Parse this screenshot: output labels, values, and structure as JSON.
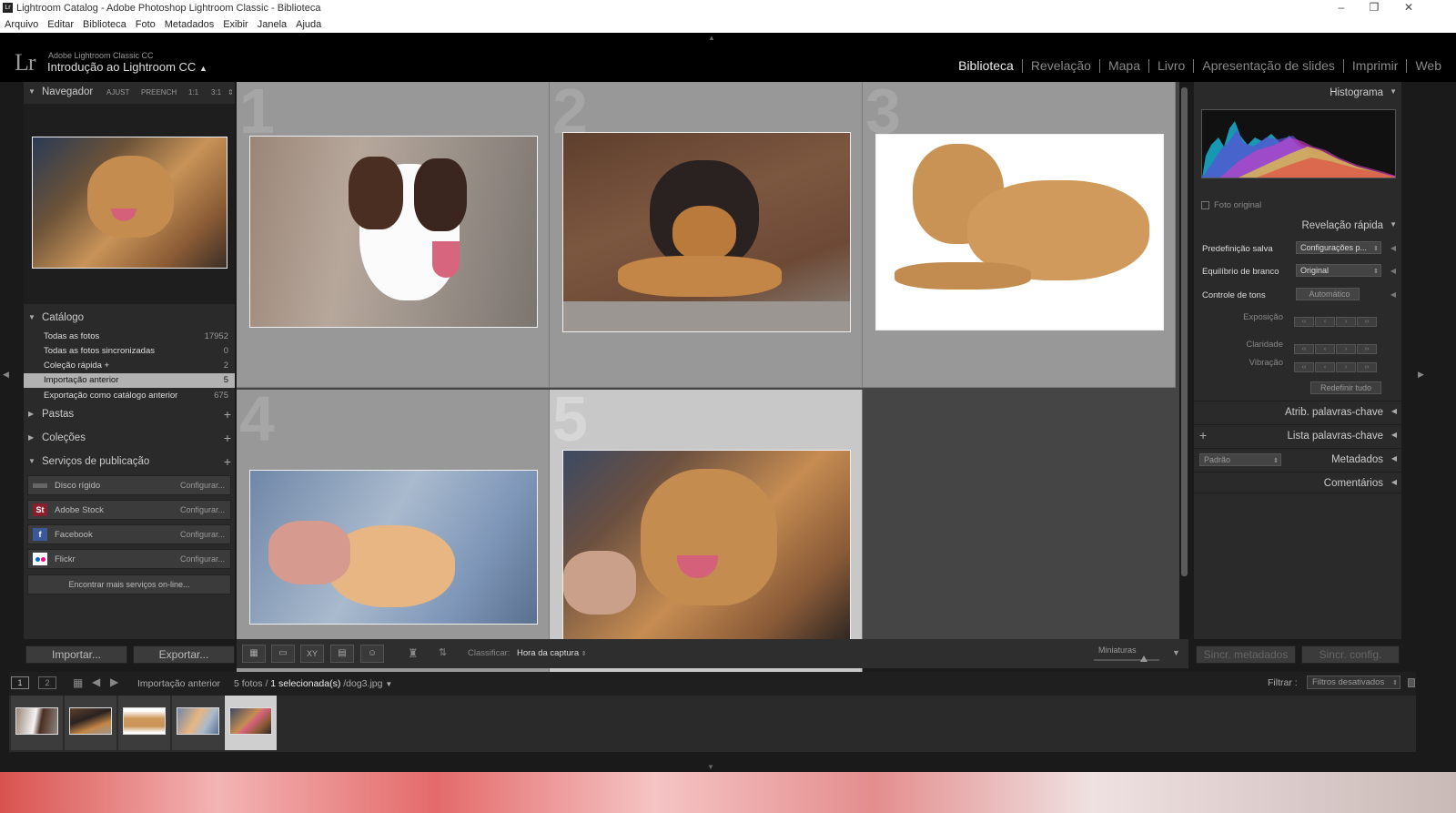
{
  "window": {
    "title": "Lightroom Catalog - Adobe Photoshop Lightroom Classic - Biblioteca",
    "minimize": "–",
    "maximize": "❐",
    "close": "✕"
  },
  "menu": [
    "Arquivo",
    "Editar",
    "Biblioteca",
    "Foto",
    "Metadados",
    "Exibir",
    "Janela",
    "Ajuda"
  ],
  "identity": {
    "logo": "Lr",
    "app_name": "Adobe Lightroom Classic CC",
    "catalog_name": "Introdução ao Lightroom CC",
    "modules": [
      "Biblioteca",
      "Revelação",
      "Mapa",
      "Livro",
      "Apresentação de slides",
      "Imprimir",
      "Web"
    ],
    "active_module": "Biblioteca"
  },
  "navigator": {
    "title": "Navegador",
    "options": [
      "AJUST",
      "PREENCH",
      "1:1",
      "3:1"
    ]
  },
  "catalog": {
    "title": "Catálogo",
    "rows": [
      {
        "name": "Todas as fotos",
        "count": "17952"
      },
      {
        "name": "Todas as fotos sincronizadas",
        "count": "0"
      },
      {
        "name": "Coleção rápida +",
        "count": "2"
      },
      {
        "name": "Importação anterior",
        "count": "5"
      },
      {
        "name": "Exportação como catálogo anterior",
        "count": "675"
      }
    ],
    "selected_index": 3
  },
  "folders": {
    "title": "Pastas"
  },
  "collections": {
    "title": "Coleções"
  },
  "publish": {
    "title": "Serviços de publicação",
    "services": [
      {
        "name": "Disco rígido",
        "configure": "Configurar..."
      },
      {
        "name": "Adobe Stock",
        "configure": "Configurar...",
        "icon": "St"
      },
      {
        "name": "Facebook",
        "configure": "Configurar...",
        "icon": "f"
      },
      {
        "name": "Flickr",
        "configure": "Configurar..."
      }
    ],
    "find_more": "Encontrar mais serviços on-line..."
  },
  "grid": {
    "cells": [
      {
        "number": "1"
      },
      {
        "number": "2"
      },
      {
        "number": "3"
      },
      {
        "number": "4"
      },
      {
        "number": "5"
      }
    ],
    "selected_index": 4
  },
  "right": {
    "histogram": "Histograma",
    "original_photo": "Foto original",
    "quick_develop": "Revelação rápida",
    "saved_preset_label": "Predefinição salva",
    "saved_preset_value": "Configurações p...",
    "white_balance_label": "Equilíbrio de branco",
    "white_balance_value": "Original",
    "tone_control_label": "Controle de tons",
    "tone_control_value": "Automático",
    "exposure": "Exposição",
    "clarity": "Claridade",
    "vibrance": "Vibração",
    "reset_all": "Redefinir tudo",
    "keywording": "Atrib. palavras-chave",
    "keyword_list": "Lista palavras-chave",
    "metadata": "Metadados",
    "metadata_preset": "Padrão",
    "comments": "Comentários"
  },
  "toolbar": {
    "import": "Importar...",
    "export": "Exportar...",
    "sort_label": "Classificar:",
    "sort_value": "Hora da captura",
    "thumbnails": "Miniaturas",
    "sync_metadata": "Sincr. metadados",
    "sync_settings": "Sincr. config."
  },
  "filmstrip": {
    "screen1": "1",
    "screen2": "2",
    "source": "Importação anterior",
    "photos_count": "5 fotos /",
    "selected": "1 selecionada(s)",
    "filename": "/dog3.jpg",
    "filter_label": "Filtrar :",
    "filter_value": "Filtros desativados"
  },
  "colors": {
    "accent_active": "#eeeeee",
    "panel_bg": "#2a2a2a",
    "grid_cell": "#989898",
    "grid_cell_selected": "#c8c8c8"
  }
}
